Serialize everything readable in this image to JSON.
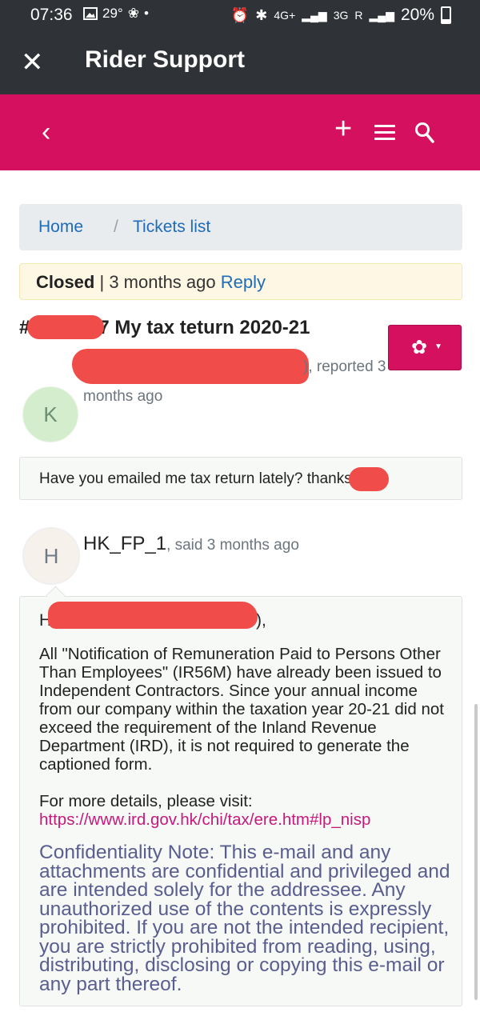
{
  "status_bar": {
    "time": "07:36",
    "weather": "29°",
    "network_4g": "4G+",
    "network_3g": "3G",
    "roaming": "R",
    "battery": "20%"
  },
  "app_bar": {
    "title": "Rider Support"
  },
  "toolbar": {
    "back_icon": "chevron-left-icon",
    "add_icon": "plus-icon",
    "menu_icon": "hamburger-icon",
    "search_icon": "search-icon"
  },
  "breadcrumb": {
    "home": "Home",
    "separator": "/",
    "current": "Tickets list"
  },
  "ticket": {
    "status": "Closed",
    "separator": " | ",
    "age": "3 months ago",
    "reply_label": "Reply",
    "number_prefix": "#",
    "title_visible": "7 My tax teturn 2020-21",
    "reporter_suffix": "), reported 3",
    "reported_continued": "months ago",
    "reporter_avatar_letter": "K"
  },
  "messages": [
    {
      "text": "Have you emailed me tax return lately? thanks"
    },
    {
      "author": "HK_FP_1",
      "said": ", said 3 months ago",
      "avatar_letter": "H",
      "greeting_start": "H",
      "greeting_end": "),",
      "body": "All \"Notification of Remuneration Paid to Persons Other Than Employees\" (IR56M) have already been issued to Independent Contractors. Since your annual income from our company within the taxation year 20-21 did not exceed the requirement of the Inland Revenue Department (IRD), it is not required to generate the captioned form.",
      "more_details": "For more details, please visit:",
      "link": "https://www.ird.gov.hk/chi/tax/ere.htm#lp_nisp",
      "confidentiality": "Confidentiality Note: This e-mail and any attachments are confidential and privileged and are intended solely for the addressee. Any unauthorized use of the contents is expressly prohibited. If you are not the intended recipient, you are strictly prohibited from reading, using, distributing, disclosing or copying this e-mail or any part thereof."
    }
  ],
  "colors": {
    "brand": "#d5105f",
    "dark_bar": "#2f3337",
    "link": "#1e6bb8",
    "redaction": "#ef4c4a"
  }
}
